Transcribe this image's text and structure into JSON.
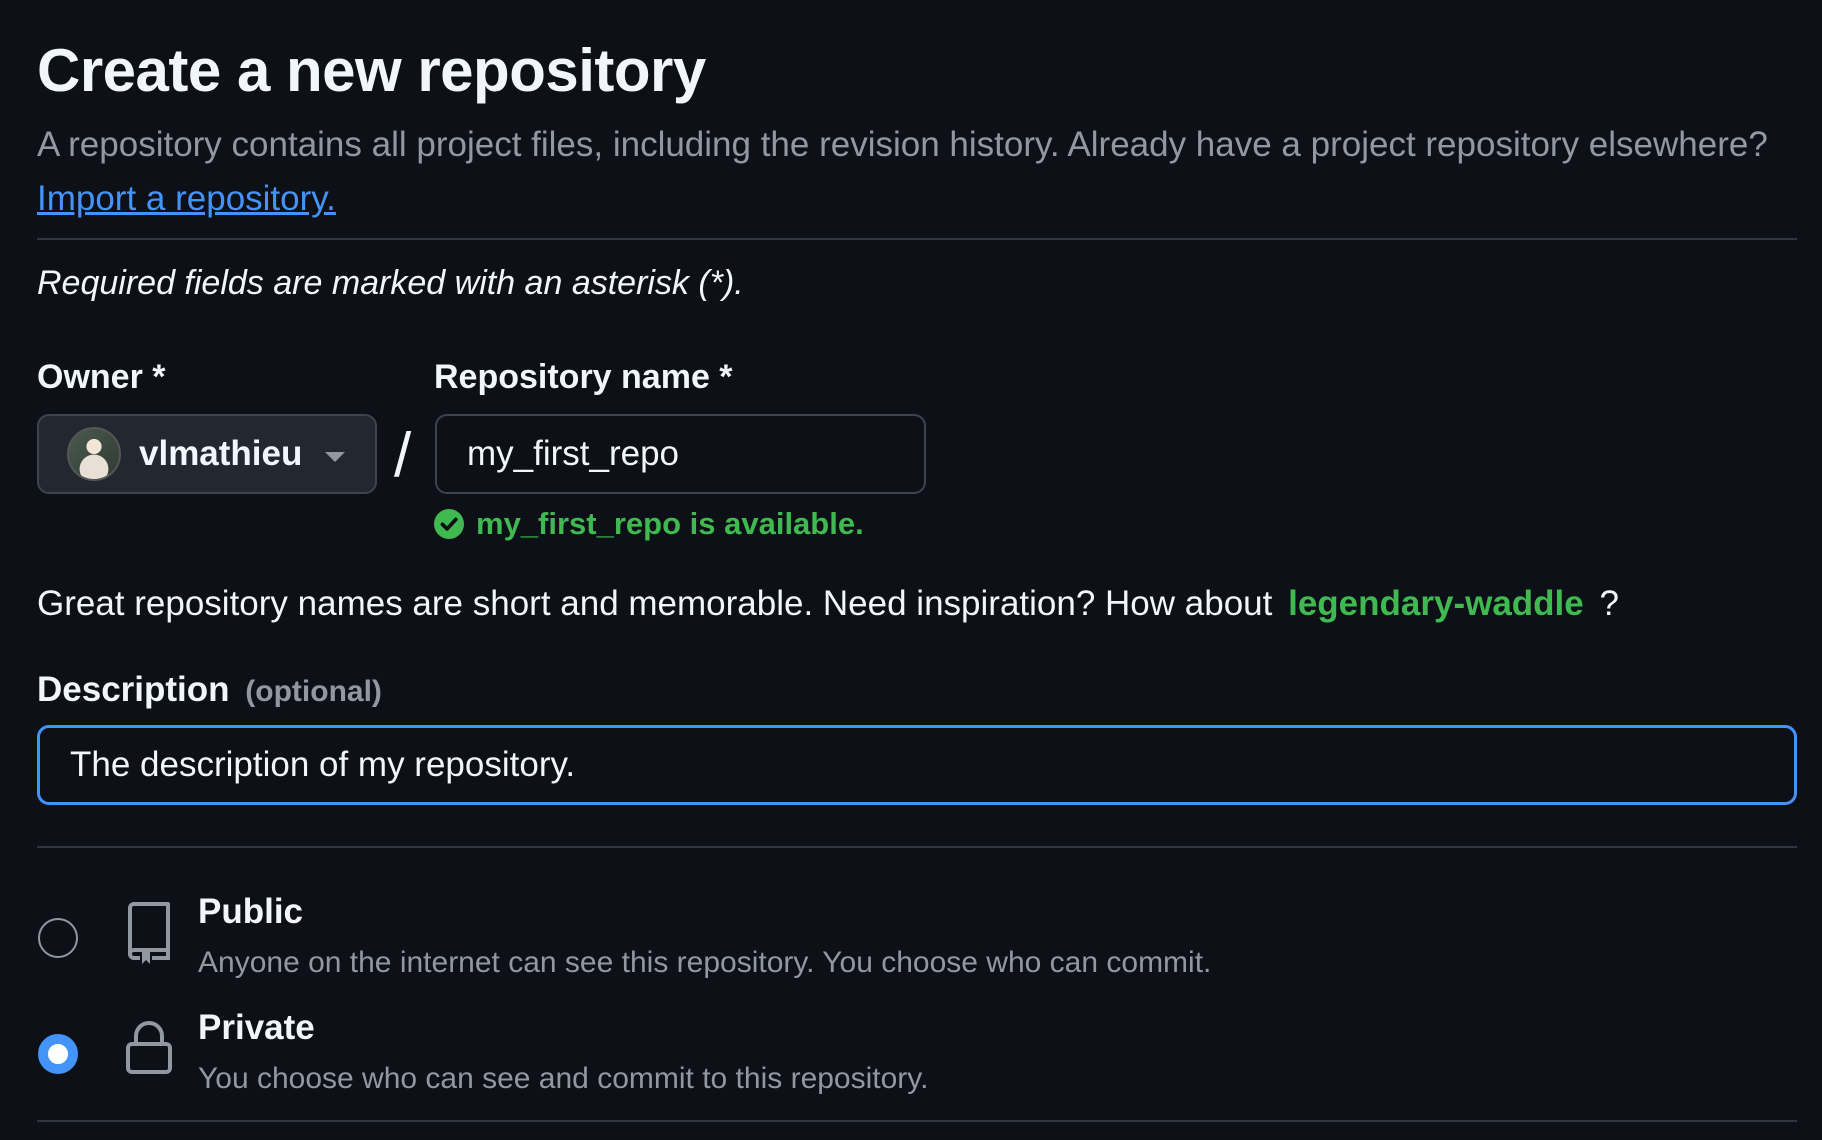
{
  "header": {
    "title": "Create a new repository",
    "subtitle": "A repository contains all project files, including the revision history. Already have a project repository elsewhere?",
    "import_link": "Import a repository."
  },
  "required_note": "Required fields are marked with an asterisk (*).",
  "owner": {
    "label": "Owner *",
    "value": "vlmathieu"
  },
  "separator": "/",
  "repository_name": {
    "label": "Repository name *",
    "value": "my_first_repo",
    "availability": "my_first_repo is available."
  },
  "inspiration": {
    "text": "Great repository names are short and memorable. Need inspiration? How about",
    "suggestion": "legendary-waddle",
    "suffix": "?"
  },
  "description": {
    "label": "Description",
    "optional": "(optional)",
    "value": "The description of my repository."
  },
  "visibility": {
    "options": [
      {
        "title": "Public",
        "description": "Anyone on the internet can see this repository. You choose who can commit.",
        "icon": "repo-icon",
        "selected": false
      },
      {
        "title": "Private",
        "description": "You choose who can see and commit to this repository.",
        "icon": "lock-icon",
        "selected": true
      }
    ]
  },
  "colors": {
    "background": "#0d1117",
    "accent": "#4493f8",
    "success": "#3fb950",
    "muted": "#9198a1"
  }
}
